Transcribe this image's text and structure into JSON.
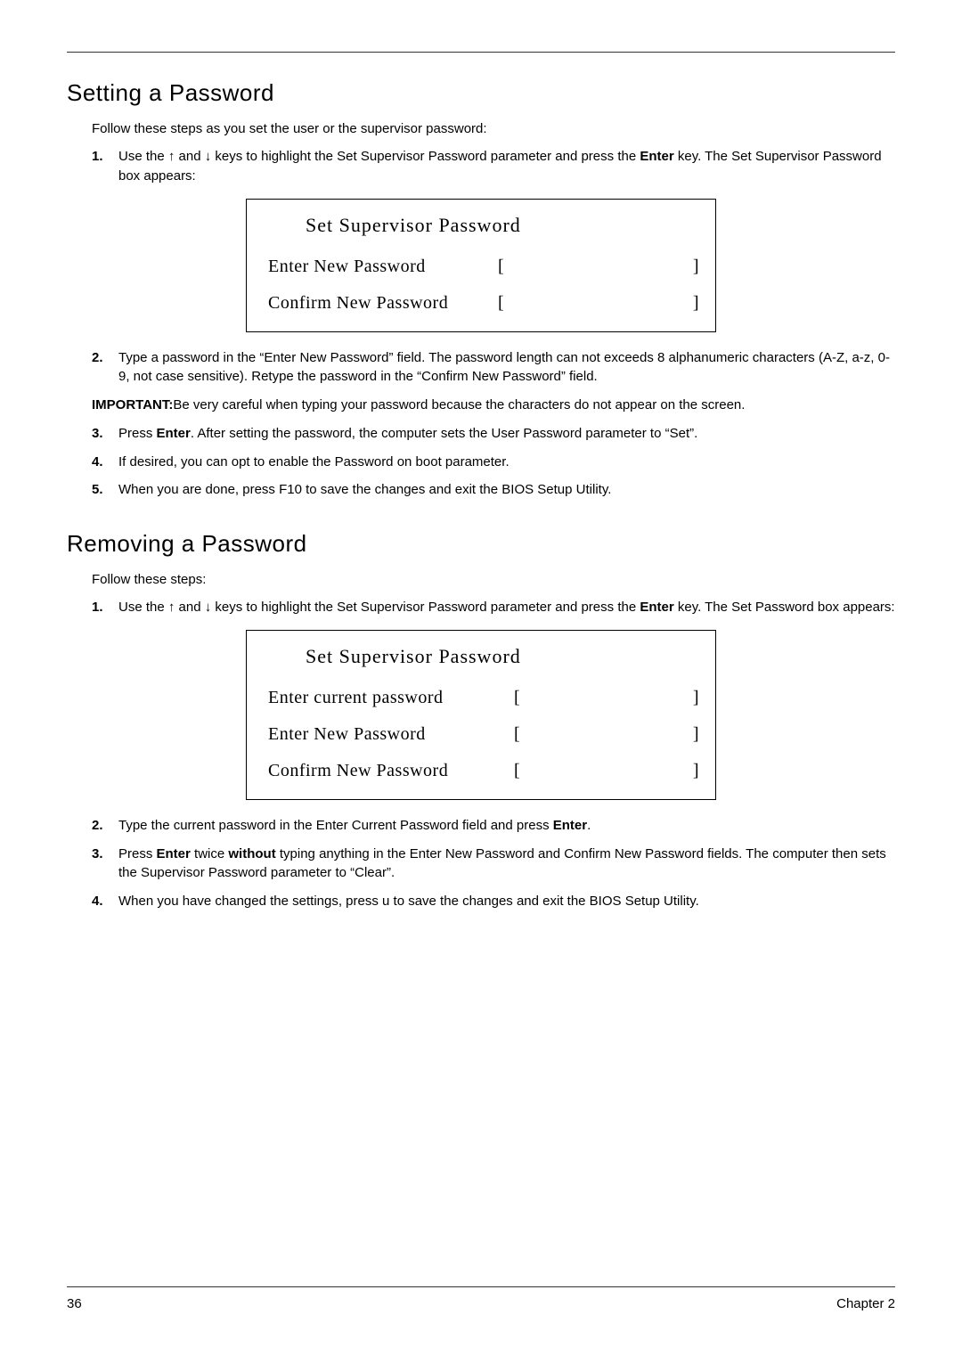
{
  "sections": {
    "set": {
      "heading": "Setting a Password",
      "intro": "Follow these steps as you set the user or the supervisor password:",
      "step1_a": "Use the ",
      "step1_b": " and ",
      "step1_c": " keys to highlight the Set Supervisor Password parameter and press the ",
      "step1_enter": "Enter",
      "step1_d": " key. The Set Supervisor Password box appears:",
      "dialog1": {
        "title": "Set Supervisor Password",
        "row1": "Enter New Password",
        "row2": "Confirm New Password"
      },
      "step2": "Type a password in the “Enter New Password” field. The password length can not exceeds 8 alphanumeric characters (A-Z, a-z, 0-9, not case sensitive). Retype the password in the “Confirm New Password” field.",
      "important_label": "IMPORTANT:",
      "important_text": "Be very careful when typing your password because the characters do not appear on the screen.",
      "step3_a": "Press ",
      "step3_enter": "Enter",
      "step3_b": ". After setting the password, the computer sets the User Password parameter to “Set”.",
      "step4": "If desired, you can opt to enable the Password on boot parameter.",
      "step5": "When you are done, press F10 to save the changes and exit the BIOS Setup Utility."
    },
    "remove": {
      "heading": "Removing a Password",
      "intro": "Follow these steps:",
      "step1_a": "Use the ",
      "step1_b": " and ",
      "step1_c": " keys to highlight the Set Supervisor Password parameter and press the ",
      "step1_enter": "Enter",
      "step1_d": " key. The Set Password box appears:",
      "dialog2": {
        "title": "Set Supervisor Password",
        "row1": "Enter current password",
        "row2": "Enter New Password",
        "row3": "Confirm New Password"
      },
      "step2_a": "Type the current password in the Enter Current Password field and press ",
      "step2_enter": "Enter",
      "step2_b": ".",
      "step3_a": "Press ",
      "step3_enter": "Enter",
      "step3_b": " twice ",
      "step3_without": "without",
      "step3_c": " typing anything in the Enter New Password and Confirm New Password fields. The computer then sets the Supervisor Password parameter to “Clear”.",
      "step4": "When you have changed the settings, press u to save the changes and exit the BIOS Setup Utility."
    }
  },
  "arrows": {
    "up": "↑",
    "down": "↓"
  },
  "brackets": {
    "left": "[",
    "right": "]"
  },
  "nums": {
    "n1": "1.",
    "n2": "2.",
    "n3": "3.",
    "n4": "4.",
    "n5": "5."
  },
  "footer": {
    "page": "36",
    "chapter": "Chapter 2"
  }
}
